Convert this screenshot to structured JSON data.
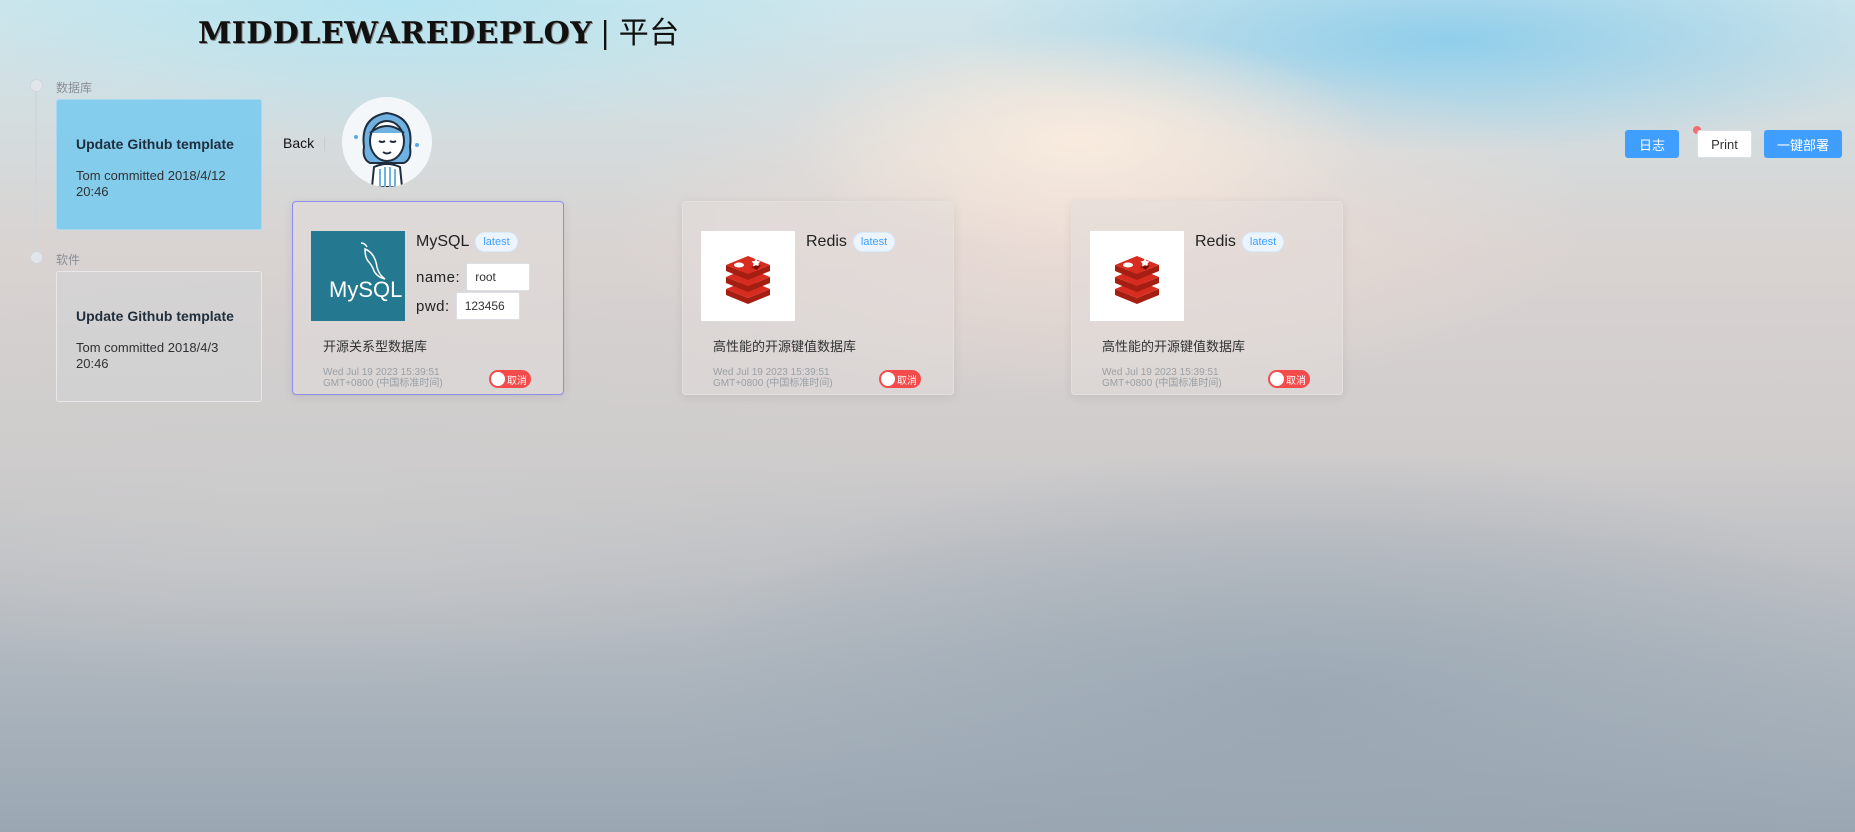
{
  "header": {
    "brand": "MIDDLEWAREDEPLOY",
    "separator": "|",
    "subtitle": "平台"
  },
  "timeline": [
    {
      "label": "数据库",
      "title": "Update Github template",
      "text": "Tom committed 2018/4/12 20:46"
    },
    {
      "label": "软件",
      "title": "Update Github template",
      "text": "Tom committed 2018/4/3 20:46"
    }
  ],
  "toolbar": {
    "back": "Back",
    "log": "日志",
    "print": "Print",
    "deploy": "一键部署"
  },
  "cards": [
    {
      "name": "MySQL",
      "tag": "latest",
      "description": "开源关系型数据库",
      "name_label": "name:",
      "name_value": "root",
      "pwd_label": "pwd:",
      "pwd_value": "123456",
      "timestamp": "Wed Jul 19 2023 15:39:51 GMT+0800 (中国标准时间)",
      "switch_label": "取消"
    },
    {
      "name": "Redis",
      "tag": "latest",
      "description": "高性能的开源键值数据库",
      "timestamp": "Wed Jul 19 2023 15:39:51 GMT+0800 (中国标准时间)",
      "switch_label": "取消"
    },
    {
      "name": "Redis",
      "tag": "latest",
      "description": "高性能的开源键值数据库",
      "timestamp": "Wed Jul 19 2023 15:39:51 GMT+0800 (中国标准时间)",
      "switch_label": "取消"
    }
  ],
  "logos": {
    "mysql_text": "MySQL",
    "mysql_bg": "#24788f",
    "mysql_accent": "#f29111",
    "redis_red": "#d82c20"
  },
  "colors": {
    "primary": "#409eff",
    "danger": "#f34b4b",
    "timeline_active": "#80cbec",
    "card_selected_border": "#8f8cf0"
  },
  "icons": {
    "avatar": "woman-avatar-icon",
    "mysql": "mysql-dolphin-logo",
    "redis": "redis-cube-logo"
  }
}
